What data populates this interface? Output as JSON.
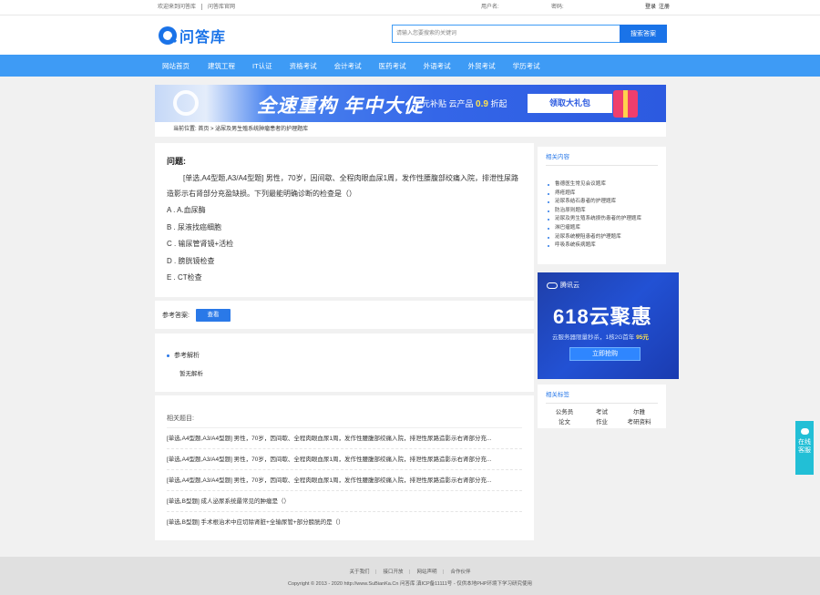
{
  "topbar": {
    "welcome": "欢迎来到问答库",
    "official": "问答库官网",
    "user_label": "用户名:",
    "password_label": "密码:",
    "register": "注册",
    "login": "登录"
  },
  "header": {
    "logo_text": "问答库",
    "search_placeholder": "请输入您要搜索的关键词",
    "search_button": "搜索答案"
  },
  "nav": [
    "网站首页",
    "建筑工程",
    "IT认证",
    "资格考试",
    "会计考试",
    "医药考试",
    "外语考试",
    "外贸考试",
    "学历考试"
  ],
  "banner": {
    "headline": "全速重构 年中大促",
    "sub_prefix": "亿元补贴 云产品",
    "sub_highlight": "0.9",
    "sub_suffix": "折起",
    "button": "领取大礼包"
  },
  "breadcrumb": "当前位置: 首页 > 泌尿及男生殖系统肿瘤患者的护理题库",
  "question": {
    "title": "问题:",
    "body": "[单选,A4型题,A3/A4型题] 男性，70岁，因间歇、全程肉眼血尿1周，发作性腰腹部绞痛入院，排泄性尿路造影示右肾部分充盈缺损。下列最能明确诊断的检查是（）",
    "options": [
      "A . A.血尿酶",
      "B . 尿液找癌细胞",
      "C . 输尿管肾镜+活检",
      "D . 膀胱镜检查",
      "E . CT检查"
    ]
  },
  "answer": {
    "label": "参考答案:",
    "view_button": "查看"
  },
  "analysis": {
    "title": "参考解析",
    "content": "暂无解析"
  },
  "related": {
    "title": "相关题目:",
    "items": [
      "[单选,A4型题,A3/A4型题] 男性，70岁，因间歇、全程肉眼血尿1周，发作性腰腹部绞痛入院，排泄性尿路造影示右肾部分充...",
      "[单选,A4型题,A3/A4型题] 男性，70岁，因间歇、全程肉眼血尿1周，发作性腰腹部绞痛入院，排泄性尿路造影示右肾部分充...",
      "[单选,A4型题,A3/A4型题] 男性，70岁，因间歇、全程肉眼血尿1周，发作性腰腹部绞痛入院，排泄性尿路造影示右肾部分充...",
      "[单选,B型题] 成人泌尿系统最常见的肿瘤是（）",
      "[单选,B型题] 手术根治术中应切除肾脏+全输尿管+部分膀胱的是（）"
    ]
  },
  "side_related": {
    "title": "相关内容",
    "items": [
      "鲁德医生常见会议题库",
      "痔疮题库",
      "泌尿系结石患者的护理题库",
      "防治原则题库",
      "泌尿及男生殖系统损伤患者的护理题库",
      "淋巴瘤题库",
      "泌尿系统梗阻患者的护理题库",
      "呼吸系统疾病题库"
    ]
  },
  "ad": {
    "brand": "腾讯云",
    "headline": "618云聚惠",
    "desc_prefix": "云服务器限量秒杀，1核2G首年",
    "desc_price": "95元",
    "button": "立即抢购"
  },
  "side_tags": {
    "title": "相关标签",
    "tags": [
      "公务员",
      "考试",
      "尔雅",
      "论文",
      "作业",
      "考研资料"
    ]
  },
  "service": {
    "line1": "在线",
    "line2": "客服"
  },
  "footer": {
    "links": [
      "关于我们",
      "接口开放",
      "网站声明",
      "合作伙伴"
    ],
    "copyright": "Copyright © 2013 - 2020 http://www.SuBianKa.Cn 问答库 滇ICP备11111号 - 仅供本地PHP环境下学习研究使用"
  },
  "colors": {
    "brand_blue": "#1a73e8",
    "nav_blue": "#3e9bf5",
    "service_teal": "#22bfd6"
  }
}
